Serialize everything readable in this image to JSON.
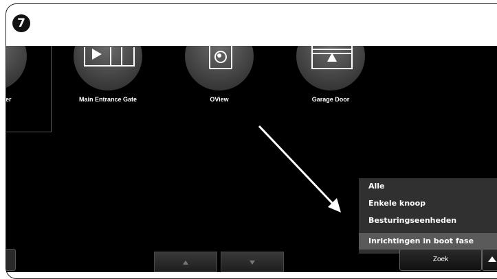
{
  "step": {
    "number": "7"
  },
  "devices": [
    {
      "label": "Receiver",
      "icon": "receiver-icon"
    },
    {
      "label": "Main Entrance Gate",
      "icon": "gate-icon"
    },
    {
      "label": "OView",
      "icon": "oview-icon"
    },
    {
      "label": "Garage Door",
      "icon": "garage-door-icon"
    }
  ],
  "filter_menu": {
    "items": [
      {
        "label": "Alle",
        "selected": false
      },
      {
        "label": "Enkele knoop",
        "selected": false
      },
      {
        "label": "Besturingseenheden",
        "selected": false
      },
      {
        "label": "Inrichtingen in boot fase",
        "selected": true
      }
    ]
  },
  "toolbar": {
    "search_label": "Zoek",
    "up_icon": "triangle-up-icon",
    "prev_icon": "triangle-up-icon",
    "next_icon": "triangle-down-icon"
  },
  "colors": {
    "screen_background": "#000000",
    "menu_background": "#303030",
    "menu_selected": "#5a5a5a",
    "text": "#ffffff"
  }
}
